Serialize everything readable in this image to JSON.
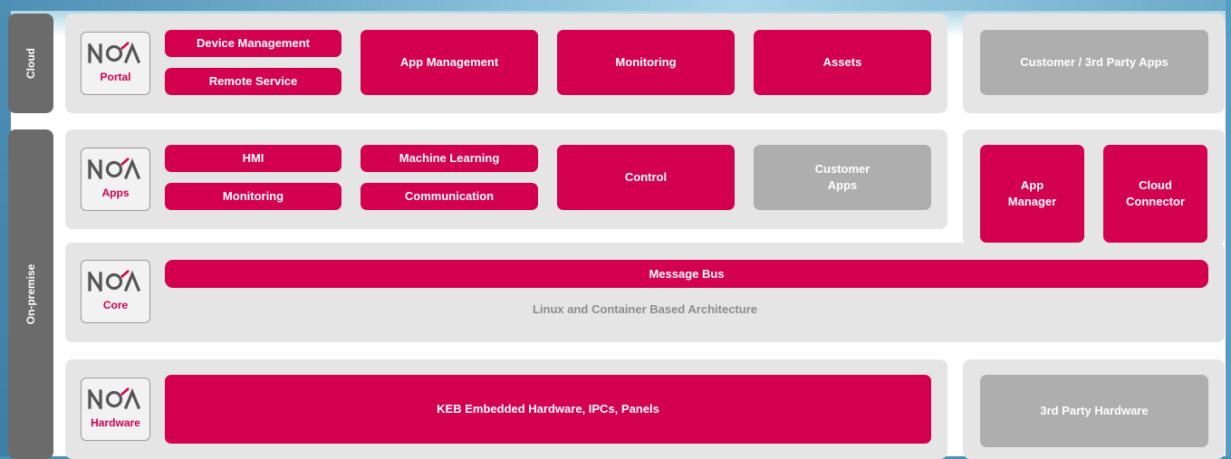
{
  "side_labels": {
    "cloud": "Cloud",
    "onpremise": "On-premise"
  },
  "logos": {
    "brand": "NOA",
    "portal": "Portal",
    "apps": "Apps",
    "core": "Core",
    "hardware": "Hardware"
  },
  "cloud": {
    "device_management": "Device Management",
    "remote_service": "Remote Service",
    "app_management": "App Management",
    "monitoring": "Monitoring",
    "assets": "Assets",
    "customer_apps": "Customer / 3rd Party Apps"
  },
  "apps": {
    "hmi": "HMI",
    "monitoring": "Monitoring",
    "machine_learning": "Machine Learning",
    "communication": "Communication",
    "control": "Control",
    "customer_apps": "Customer Apps",
    "app_manager": "App Manager",
    "cloud_connector": "Cloud Connector"
  },
  "core": {
    "message_bus": "Message Bus",
    "architecture": "Linux and Container Based Architecture"
  },
  "hardware": {
    "keb": "KEB Embedded Hardware, IPCs, Panels",
    "third_party": "3rd Party Hardware"
  },
  "colors": {
    "accent": "#d2004f",
    "grey_box": "#aeaeae",
    "panel": "#e5e5e5",
    "side": "#6b6b6b"
  }
}
